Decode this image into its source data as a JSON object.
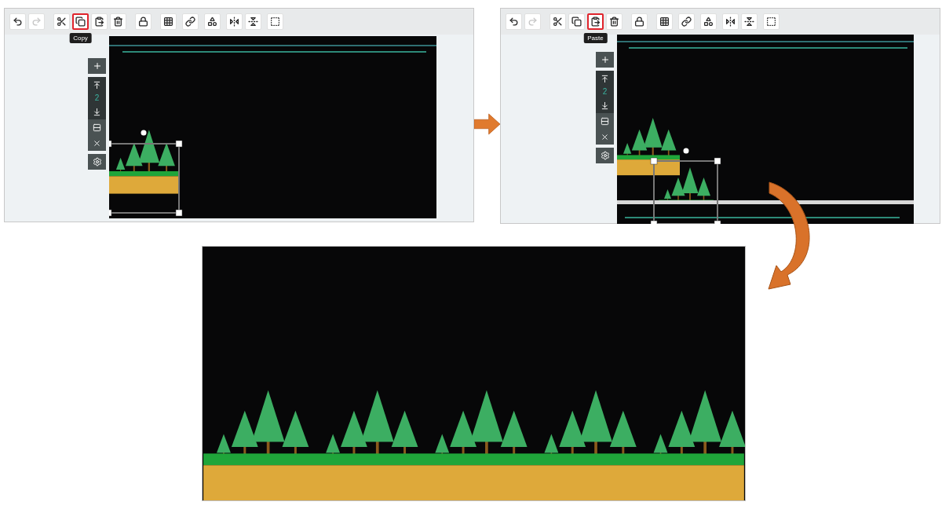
{
  "panels": [
    {
      "kind": "original",
      "tooltip": "Copy",
      "layer": "2",
      "tools": [
        {
          "kind": "undo",
          "selected": false,
          "disabled": false
        },
        {
          "kind": "redo",
          "selected": false,
          "disabled": true
        },
        {
          "kind": "cut",
          "selected": false,
          "disabled": false
        },
        {
          "kind": "copy",
          "selected": true,
          "disabled": false
        },
        {
          "kind": "paste",
          "selected": false,
          "disabled": false
        },
        {
          "kind": "delete",
          "selected": false,
          "disabled": false
        },
        {
          "kind": "lock",
          "selected": false,
          "disabled": false
        },
        {
          "kind": "pattern",
          "selected": false,
          "disabled": false
        },
        {
          "kind": "link",
          "selected": false,
          "disabled": false
        },
        {
          "kind": "shape",
          "selected": false,
          "disabled": false
        },
        {
          "kind": "flip-h",
          "selected": false,
          "disabled": false
        },
        {
          "kind": "flip-v",
          "selected": false,
          "disabled": false
        },
        {
          "kind": "arrange",
          "selected": false,
          "disabled": false
        }
      ]
    },
    {
      "kind": "duplicated",
      "tooltip": "Paste",
      "layer": "2",
      "tools": [
        {
          "kind": "undo",
          "selected": false,
          "disabled": false
        },
        {
          "kind": "redo",
          "selected": false,
          "disabled": true
        },
        {
          "kind": "cut",
          "selected": false,
          "disabled": false
        },
        {
          "kind": "copy",
          "selected": false,
          "disabled": false
        },
        {
          "kind": "paste",
          "selected": true,
          "disabled": false
        },
        {
          "kind": "delete",
          "selected": false,
          "disabled": false
        },
        {
          "kind": "lock",
          "selected": false,
          "disabled": false
        },
        {
          "kind": "pattern",
          "selected": false,
          "disabled": false
        },
        {
          "kind": "link",
          "selected": false,
          "disabled": false
        },
        {
          "kind": "shape",
          "selected": false,
          "disabled": false
        },
        {
          "kind": "flip-h",
          "selected": false,
          "disabled": false
        },
        {
          "kind": "flip-v",
          "selected": false,
          "disabled": false
        },
        {
          "kind": "arrange",
          "selected": false,
          "disabled": false
        }
      ]
    }
  ]
}
